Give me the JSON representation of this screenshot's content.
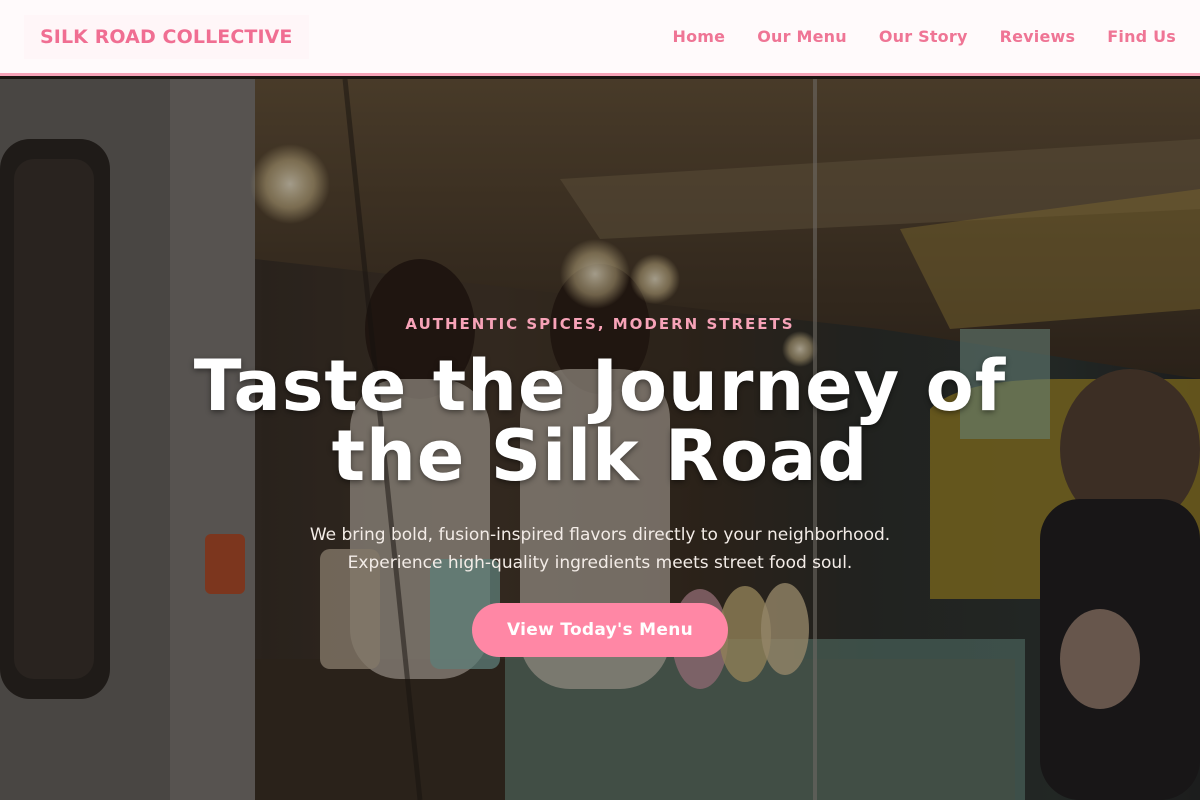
{
  "brand": {
    "name": "SILK ROAD COLLECTIVE"
  },
  "nav": {
    "items": [
      {
        "label": "Home"
      },
      {
        "label": "Our Menu"
      },
      {
        "label": "Our Story"
      },
      {
        "label": "Reviews"
      },
      {
        "label": "Find Us"
      }
    ]
  },
  "hero": {
    "tagline": "AUTHENTIC SPICES, MODERN STREETS",
    "headline": "Taste the Journey of the Silk Road",
    "subline_1": "We bring bold, fusion-inspired flavors directly to your neighborhood.",
    "subline_2": "Experience high-quality ingredients meets street food soul.",
    "cta_label": "View Today's Menu",
    "background_image": "food-truck-night-photo"
  },
  "colors": {
    "accent": "#f06e92",
    "nav_link": "#ef7595",
    "tagline": "#f7a3b8",
    "cta": "#ff87a5",
    "nav_border": "#f7a3b8"
  }
}
